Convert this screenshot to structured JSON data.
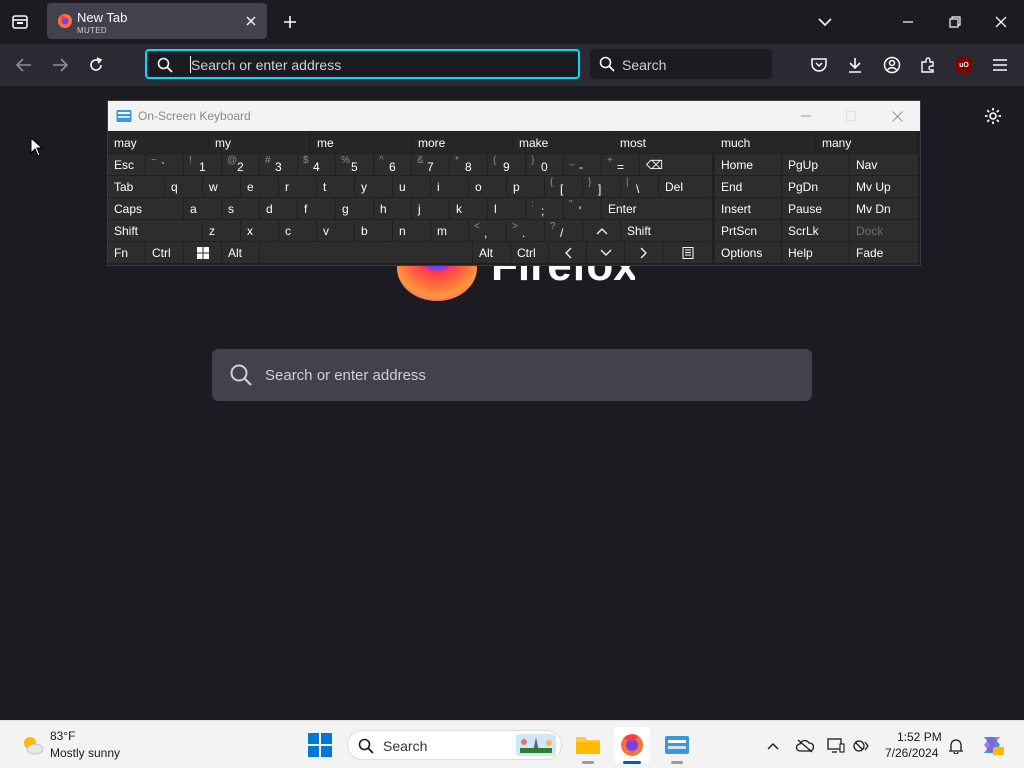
{
  "browser": {
    "tab": {
      "title": "New Tab",
      "subtitle": "MUTED"
    },
    "urlbar": {
      "placeholder": "Search or enter address"
    },
    "searchbar": {
      "placeholder": "Search"
    }
  },
  "newtab": {
    "logo_word": "Firefox",
    "search_placeholder": "Search or enter address"
  },
  "osk": {
    "title": "On-Screen Keyboard",
    "suggestions": [
      "may",
      "my",
      "me",
      "more",
      "make",
      "most",
      "much",
      "many"
    ],
    "row1": {
      "esc": "Esc",
      "keys": [
        {
          "s": "~",
          "m": "`"
        },
        {
          "s": "!",
          "m": "1"
        },
        {
          "s": "@",
          "m": "2"
        },
        {
          "s": "#",
          "m": "3"
        },
        {
          "s": "$",
          "m": "4"
        },
        {
          "s": "%",
          "m": "5"
        },
        {
          "s": "^",
          "m": "6"
        },
        {
          "s": "&",
          "m": "7"
        },
        {
          "s": "*",
          "m": "8"
        },
        {
          "s": "(",
          "m": "9"
        },
        {
          "s": ")",
          "m": "0"
        },
        {
          "s": "_",
          "m": "-"
        },
        {
          "s": "+",
          "m": "="
        }
      ],
      "backspace": "⌫"
    },
    "row2": {
      "tab": "Tab",
      "letters": [
        "q",
        "w",
        "e",
        "r",
        "t",
        "y",
        "u",
        "i",
        "o",
        "p"
      ],
      "brackets": [
        {
          "s": "{",
          "m": "["
        },
        {
          "s": "}",
          "m": "]"
        },
        {
          "s": "|",
          "m": "\\"
        }
      ],
      "del": "Del"
    },
    "row3": {
      "caps": "Caps",
      "letters": [
        "a",
        "s",
        "d",
        "f",
        "g",
        "h",
        "j",
        "k",
        "l"
      ],
      "punct": [
        {
          "s": ":",
          "m": ";"
        },
        {
          "s": "\"",
          "m": "'"
        }
      ],
      "enter": "Enter"
    },
    "row4": {
      "shift": "Shift",
      "letters": [
        "z",
        "x",
        "c",
        "v",
        "b",
        "n",
        "m"
      ],
      "punct": [
        {
          "s": "<",
          "m": ","
        },
        {
          "s": ">",
          "m": "."
        },
        {
          "s": "?",
          "m": "/"
        }
      ],
      "shift_right": "Shift"
    },
    "row5": {
      "fn": "Fn",
      "ctrl": "Ctrl",
      "alt": "Alt",
      "alt_right": "Alt",
      "ctrl_right": "Ctrl"
    },
    "nav": [
      [
        "Home",
        "PgUp",
        "Nav"
      ],
      [
        "End",
        "PgDn",
        "Mv Up"
      ],
      [
        "Insert",
        "Pause",
        "Mv Dn"
      ],
      [
        "PrtScn",
        "ScrLk",
        "Dock"
      ],
      [
        "Options",
        "Help",
        "Fade"
      ]
    ]
  },
  "taskbar": {
    "weather_temp": "83°F",
    "weather_desc": "Mostly sunny",
    "search_placeholder": "Search",
    "time": "1:52 PM",
    "date": "7/26/2024"
  },
  "colors": {
    "accent_focus": "#00ddff",
    "firefox_orange": "#ff7139",
    "windows_blue": "#0078d4"
  }
}
